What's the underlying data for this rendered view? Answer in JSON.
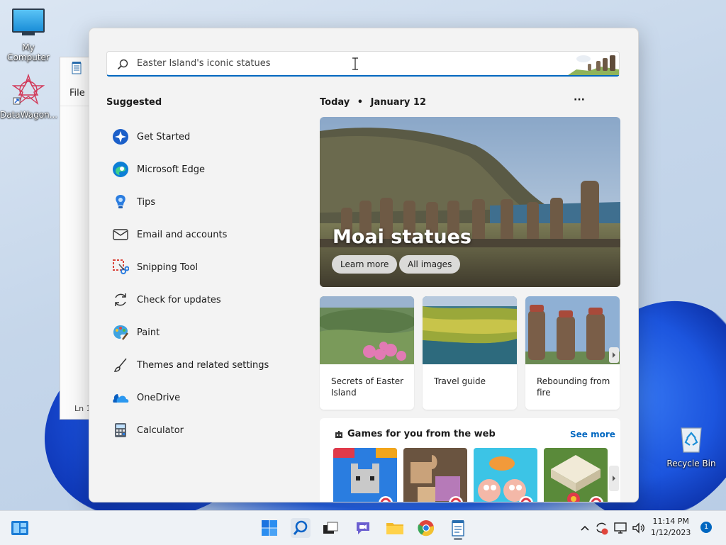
{
  "desktop": {
    "icons": [
      {
        "label": "My Computer"
      },
      {
        "label": "DataWagon..."
      },
      {
        "label": "Recycle Bin"
      }
    ],
    "background_notepad": {
      "menu_file": "File",
      "status_ln": "Ln 1"
    }
  },
  "start_menu": {
    "search": {
      "value": "Easter Island's iconic statues"
    },
    "suggested": {
      "title": "Suggested",
      "items": [
        {
          "label": "Get Started",
          "icon": "get-started-icon"
        },
        {
          "label": "Microsoft Edge",
          "icon": "edge-icon"
        },
        {
          "label": "Tips",
          "icon": "tips-icon"
        },
        {
          "label": "Email and accounts",
          "icon": "mail-icon"
        },
        {
          "label": "Snipping Tool",
          "icon": "snipping-tool-icon"
        },
        {
          "label": "Check for updates",
          "icon": "update-icon"
        },
        {
          "label": "Paint",
          "icon": "paint-icon"
        },
        {
          "label": "Themes and related settings",
          "icon": "brush-icon"
        },
        {
          "label": "OneDrive",
          "icon": "onedrive-icon"
        },
        {
          "label": "Calculator",
          "icon": "calculator-icon"
        }
      ]
    },
    "today": {
      "label": "Today",
      "separator": "•",
      "date": "January 12",
      "more": "···"
    },
    "hero": {
      "title": "Moai statues",
      "learn_more": "Learn more",
      "all_images": "All images"
    },
    "cards": [
      {
        "caption": "Secrets of Easter Island"
      },
      {
        "caption": "Travel guide"
      },
      {
        "caption": "Rebounding from fire"
      }
    ],
    "games": {
      "title": "Games for you from the web",
      "see_more": "See more"
    }
  },
  "taskbar": {
    "time": "11:14 PM",
    "date": "1/12/2023",
    "notification_count": "1",
    "apps": [
      "widgets-icon",
      "start-icon",
      "search-icon",
      "task-view-icon",
      "chat-icon",
      "file-explorer-icon",
      "chrome-icon",
      "notepad-icon"
    ]
  },
  "colors": {
    "accent": "#0067c0",
    "bloom": "#1a4fd8",
    "panel": "#f3f3f3"
  }
}
